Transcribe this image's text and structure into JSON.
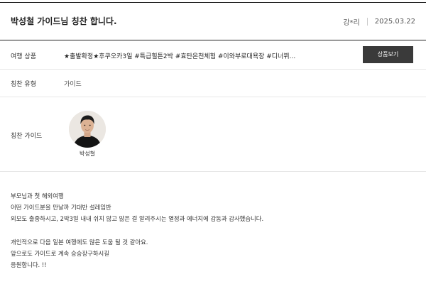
{
  "header": {
    "title": "박성철 가이드님 칭찬 합니다.",
    "author": "강*리",
    "date": "2025.03.22"
  },
  "product": {
    "label": "여행 상품",
    "value": "★출발확정★후쿠오카3일 #특급힐튼2박 #효탄온천체험 #이와부로대욕장 #디너뷔...",
    "button_label": "상품보기"
  },
  "praise_type": {
    "label": "칭찬 유형",
    "value": "가이드"
  },
  "praise_guide": {
    "label": "칭찬 가이드",
    "name": "박성철"
  },
  "content": {
    "lines": [
      "부모님과 첫 해외여행",
      "어떤 가이드분을 만날까 기대반 설레임반",
      "외모도 출중하시고, 2박3일 내내 쉬지 않고 많은 걸 알려주시는 열정과 에너지에 감동과 감사했습니다.",
      "",
      "개인적으로 다음 일본 여행에도 많은 도움 될 것 같아요.",
      "앞으로도 가이드로 계속 승승장구하시길",
      "응원합니다. !!"
    ]
  }
}
